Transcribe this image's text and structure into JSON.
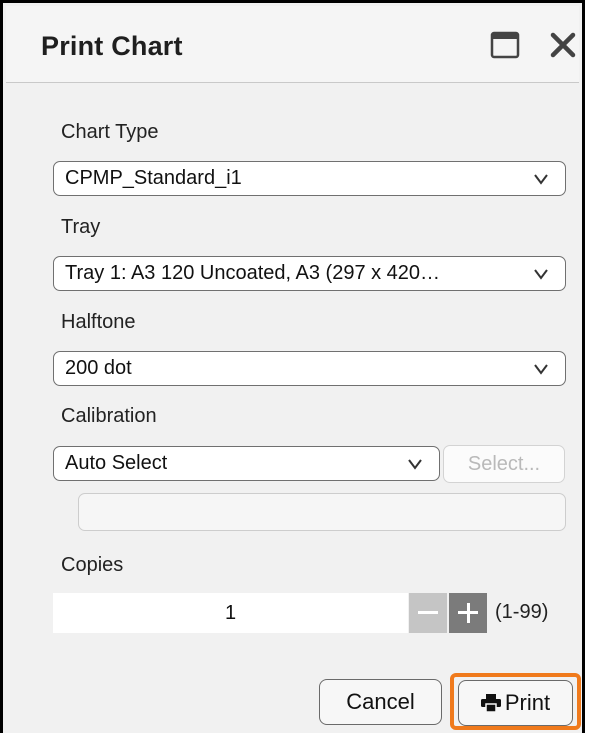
{
  "dialog": {
    "title": "Print Chart"
  },
  "fields": {
    "chart_type": {
      "label": "Chart Type",
      "value": "CPMP_Standard_i1"
    },
    "tray": {
      "label": "Tray",
      "value": "Tray 1: A3 120 Uncoated, A3 (297 x 420…"
    },
    "halftone": {
      "label": "Halftone",
      "value": "200 dot"
    },
    "calibration": {
      "label": "Calibration",
      "value": "Auto Select",
      "select_button": "Select..."
    },
    "copies": {
      "label": "Copies",
      "value": "1",
      "range": "(1-99)"
    }
  },
  "buttons": {
    "cancel": "Cancel",
    "print": "Print"
  },
  "icons": {
    "window": "window-icon",
    "close": "close-icon",
    "dropdown": "chevron-down-icon",
    "printer": "printer-icon"
  },
  "colors": {
    "accent_focus": "#f07a1c",
    "plus_button": "#7b7b7b",
    "minus_button": "#c5c5c5"
  }
}
